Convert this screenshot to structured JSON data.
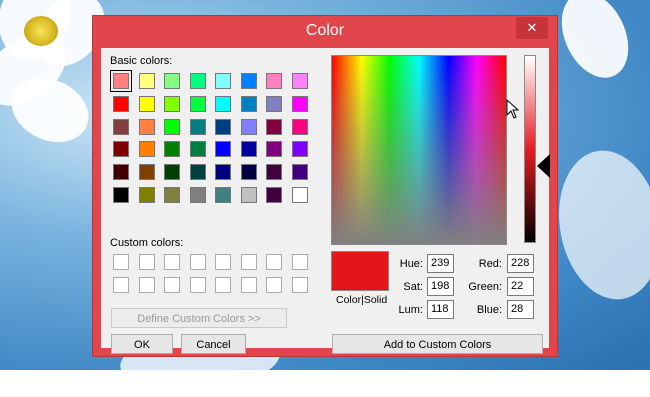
{
  "window": {
    "title": "Color",
    "close_glyph": "✕",
    "accent_color": "#e0464c"
  },
  "basic_colors_label": "Basic colors:",
  "basic_colors": [
    [
      "#ff8080",
      "#ffff80",
      "#80ff80",
      "#00ff80",
      "#80ffff",
      "#0080ff",
      "#ff80c0",
      "#ff80ff"
    ],
    [
      "#ff0000",
      "#ffff00",
      "#80ff00",
      "#00ff40",
      "#00ffff",
      "#0080c0",
      "#8080c0",
      "#ff00ff"
    ],
    [
      "#804040",
      "#ff8040",
      "#00ff00",
      "#008080",
      "#004080",
      "#8080ff",
      "#800040",
      "#ff0080"
    ],
    [
      "#800000",
      "#ff8000",
      "#008000",
      "#008040",
      "#0000ff",
      "#0000a0",
      "#800080",
      "#8000ff"
    ],
    [
      "#400000",
      "#804000",
      "#004000",
      "#004040",
      "#000080",
      "#000040",
      "#400040",
      "#400080"
    ],
    [
      "#000000",
      "#808000",
      "#808040",
      "#808080",
      "#408080",
      "#c0c0c0",
      "#400040",
      "#ffffff"
    ]
  ],
  "selected_basic_color": "#ff8080",
  "custom_colors_label": "Custom colors:",
  "custom_colors_count": 16,
  "buttons": {
    "define_custom": "Define Custom Colors >>",
    "ok": "OK",
    "cancel": "Cancel",
    "add_custom": "Add to Custom Colors"
  },
  "preview": {
    "label": "Color|Solid",
    "color": "#e4161c"
  },
  "fields": {
    "hue_label": "Hue:",
    "hue": "239",
    "sat_label": "Sat:",
    "sat": "198",
    "lum_label": "Lum:",
    "lum": "118",
    "red_label": "Red:",
    "red": "228",
    "green_label": "Green:",
    "green": "22",
    "blue_label": "Blue:",
    "blue": "28"
  },
  "icons": {
    "close": "close-icon",
    "luminosity_pointer": "triangle-left-icon",
    "mouse_cursor": "arrow-cursor-icon",
    "crosshair": "crosshair-icon"
  }
}
